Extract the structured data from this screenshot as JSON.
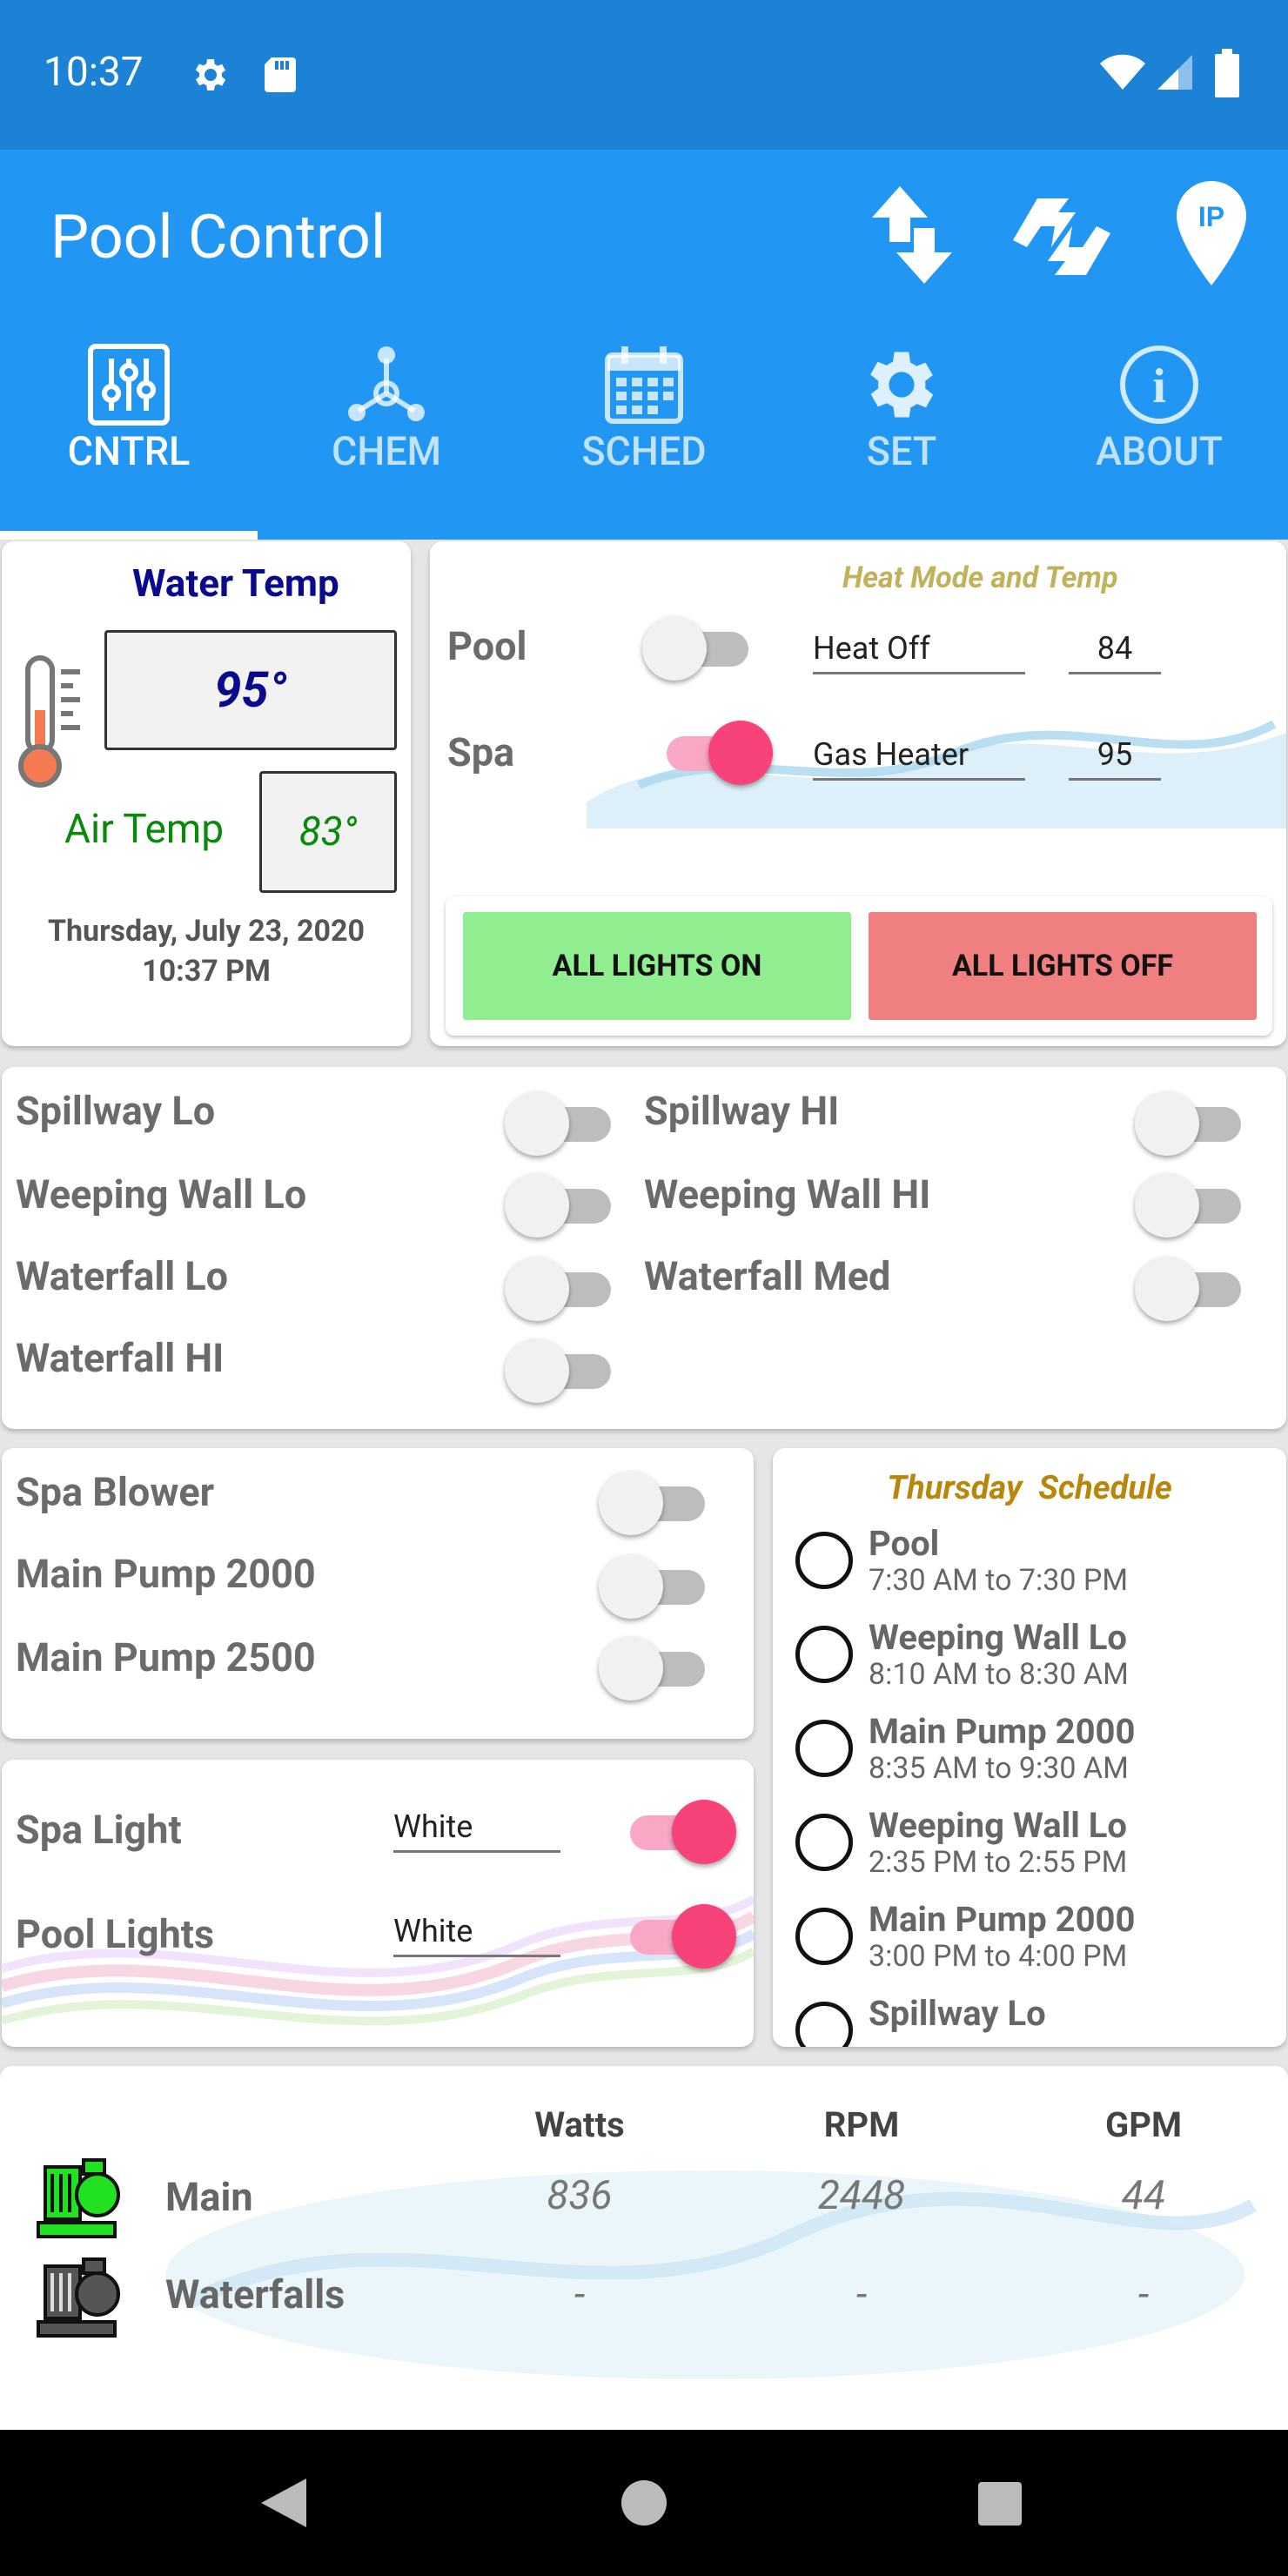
{
  "status_bar": {
    "time": "10:37"
  },
  "app": {
    "title": "Pool Control"
  },
  "tabs": [
    {
      "label": "CNTRL",
      "icon": "sliders-icon",
      "active": true
    },
    {
      "label": "CHEM",
      "icon": "molecule-icon",
      "active": false
    },
    {
      "label": "SCHED",
      "icon": "calendar-icon",
      "active": false
    },
    {
      "label": "SET",
      "icon": "gear-icon",
      "active": false
    },
    {
      "label": "ABOUT",
      "icon": "info-icon",
      "active": false
    }
  ],
  "temps": {
    "water_title": "Water Temp",
    "water_value": "95°",
    "air_label": "Air Temp",
    "air_value": "83°",
    "date": "Thursday, July 23, 2020",
    "time": "10:37 PM"
  },
  "heat": {
    "title": "Heat Mode and Temp",
    "pool_label": "Pool",
    "pool_mode": "Heat Off",
    "pool_setpoint": "84",
    "pool_on": false,
    "spa_label": "Spa",
    "spa_mode": "Gas Heater",
    "spa_setpoint": "95",
    "spa_on": true,
    "all_on": "ALL LIGHTS ON",
    "all_off": "ALL LIGHTS OFF"
  },
  "features": {
    "spillway_lo": "Spillway Lo",
    "weeping_lo": "Weeping Wall Lo",
    "waterfall_lo": "Waterfall Lo",
    "waterfall_hi": "Waterfall HI",
    "spillway_hi": "Spillway HI",
    "weeping_hi": "Weeping Wall HI",
    "waterfall_med": "Waterfall Med"
  },
  "pumps": {
    "spa_blower": "Spa Blower",
    "main_2000": "Main Pump 2000",
    "main_2500": "Main Pump 2500"
  },
  "lights": {
    "spa_label": "Spa Light",
    "spa_color": "White",
    "pool_label": "Pool Lights",
    "pool_color": "White"
  },
  "schedule": {
    "title": "Thursday  Schedule",
    "items": [
      {
        "name": "Pool",
        "time": "7:30 AM to 7:30 PM"
      },
      {
        "name": "Weeping Wall Lo",
        "time": "8:10 AM to 8:30 AM"
      },
      {
        "name": "Main Pump 2000",
        "time": "8:35 AM to 9:30 AM"
      },
      {
        "name": "Weeping Wall Lo",
        "time": "2:35 PM to 2:55 PM"
      },
      {
        "name": "Main Pump 2000",
        "time": "3:00 PM to 4:00 PM"
      },
      {
        "name": "Spillway Lo",
        "time": ""
      }
    ]
  },
  "pump_stats": {
    "headers": [
      "Watts",
      "RPM",
      "GPM"
    ],
    "rows": [
      {
        "name": "Main",
        "watts": "836",
        "rpm": "2448",
        "gpm": "44",
        "color": "#22e022"
      },
      {
        "name": "Waterfalls",
        "watts": "-",
        "rpm": "-",
        "gpm": "-",
        "color": "#555555"
      }
    ]
  },
  "colors": {
    "primary": "#2196f3",
    "status": "#1b82d6",
    "accent": "#f7427a",
    "on_button": "#90ee90",
    "off_button": "#f08080"
  }
}
